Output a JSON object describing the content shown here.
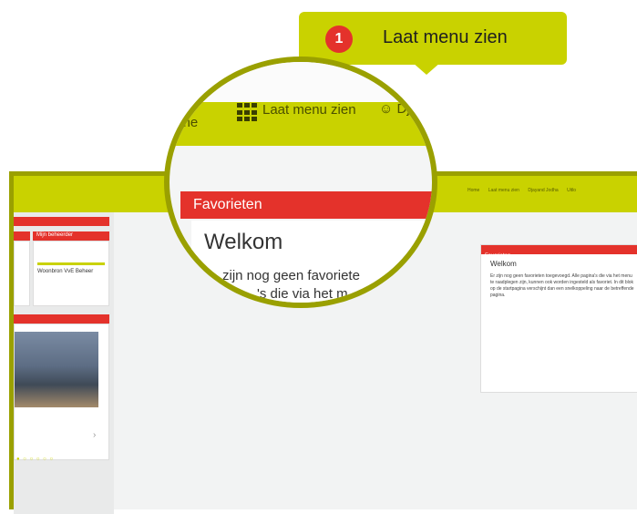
{
  "callout": {
    "step": "1",
    "label": "Laat menu zien"
  },
  "zoom": {
    "home": "ome",
    "menu": "Laat menu zien",
    "user": "Dj",
    "card_title": "Favorieten",
    "welkom": "Welkom",
    "body_line1": "zijn nog geen favoriete",
    "body_line2": "'s die via het m"
  },
  "mini": {
    "nav": {
      "home": "Home",
      "menu": "Laat menu zien",
      "user": "Djayand Jodha",
      "logout": "Uitlo"
    },
    "tiles": {
      "mijn_beheerder": "Mijn beheerder",
      "woonbron": "Woonbron VvE Beheer"
    },
    "favorieten": {
      "title": "Favorieten",
      "welkom": "Welkom",
      "body": "Er zijn nog geen favorieten toegevoegd. Alle pagina's die via het menu te raadplegen zijn, kunnen ook worden ingesteld als favoriet. In dit blok op de startpagina verschijnt dan een snelkoppeling naar de betreffende pagina."
    }
  }
}
